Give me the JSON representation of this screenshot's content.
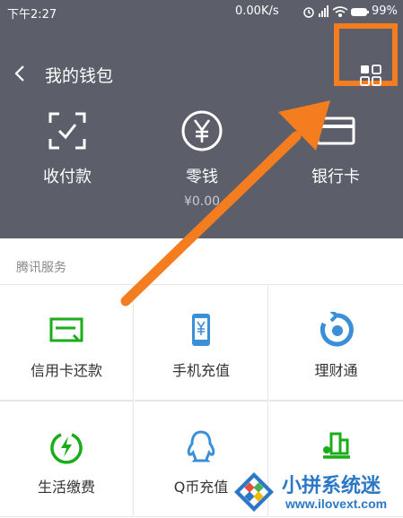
{
  "status_bar": {
    "time": "下午2:27",
    "network_speed": "0.00K/s",
    "battery_percent": "99%",
    "icons": [
      "alarm-icon",
      "signal-icon",
      "wifi-icon",
      "battery-icon"
    ]
  },
  "header": {
    "title": "我的钱包",
    "back_icon": "chevron-left-icon",
    "menu_icon": "grid-icon",
    "highlight_color": "#f47d20",
    "background_color": "#5c5f6a"
  },
  "quick_actions": [
    {
      "label": "收付款",
      "icon": "scan-pay-icon"
    },
    {
      "label": "零钱",
      "icon": "yuan-coin-icon",
      "sub": "¥0.00"
    },
    {
      "label": "银行卡",
      "icon": "bank-card-icon"
    }
  ],
  "section": {
    "title": "腾讯服务",
    "items": [
      {
        "label": "信用卡还款",
        "icon": "credit-card-icon",
        "color": "#1aad19"
      },
      {
        "label": "手机充值",
        "icon": "phone-yuan-icon",
        "color": "#3b8fd9"
      },
      {
        "label": "理财通",
        "icon": "wealth-icon",
        "color": "#3b8fd9"
      },
      {
        "label": "生活缴费",
        "icon": "lightning-icon",
        "color": "#1aad19"
      },
      {
        "label": "Q币充值",
        "icon": "qq-penguin-icon",
        "color": "#3b8fd9"
      },
      {
        "label": "",
        "icon": "city-icon",
        "color": "#1aad19"
      }
    ]
  },
  "watermark": {
    "text": "小拼系统迷",
    "url": "www.ilovext.com"
  }
}
